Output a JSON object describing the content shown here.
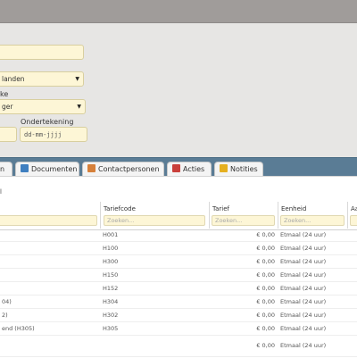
{
  "form": {
    "country_value": "landen",
    "field_label_partial": "ke",
    "select2_value": "ger",
    "signature_label": "Ondertekening",
    "date_placeholder": "dd-mm-jjjj"
  },
  "tabs": [
    {
      "label": "n",
      "icon": "partial-tab-icon"
    },
    {
      "label": "Documenten",
      "icon": "documents-icon"
    },
    {
      "label": "Contactpersonen",
      "icon": "contacts-icon"
    },
    {
      "label": "Acties",
      "icon": "actions-icon"
    },
    {
      "label": "Notities",
      "icon": "notes-icon"
    }
  ],
  "table": {
    "top_marker": "l",
    "columns": [
      "Tariefcode",
      "Tarief",
      "Eenheid",
      "Aa"
    ],
    "filter_placeholder": "Zoeken...",
    "rows": [
      {
        "name": "",
        "code": "H001",
        "price": "€ 0,00",
        "unit": "Etmaal (24 uur)"
      },
      {
        "name": "",
        "code": "H100",
        "price": "€ 0,00",
        "unit": "Etmaal (24 uur)"
      },
      {
        "name": "",
        "code": "H300",
        "price": "€ 0,00",
        "unit": "Etmaal (24 uur)"
      },
      {
        "name": "",
        "code": "H150",
        "price": "€ 0,00",
        "unit": "Etmaal (24 uur)"
      },
      {
        "name": "",
        "code": "H152",
        "price": "€ 0,00",
        "unit": "Etmaal (24 uur)"
      },
      {
        "name": "04)",
        "code": "H304",
        "price": "€ 0,00",
        "unit": "Etmaal (24 uur)"
      },
      {
        "name": "2)",
        "code": "H302",
        "price": "€ 0,00",
        "unit": "Etmaal (24 uur)"
      },
      {
        "name": "end (H305)",
        "code": "H305",
        "price": "€ 0,00",
        "unit": "Etmaal (24 uur)"
      },
      {
        "name": "",
        "code": "",
        "price": "€ 0,00",
        "unit": "Etmaal (24 uur)"
      }
    ]
  }
}
